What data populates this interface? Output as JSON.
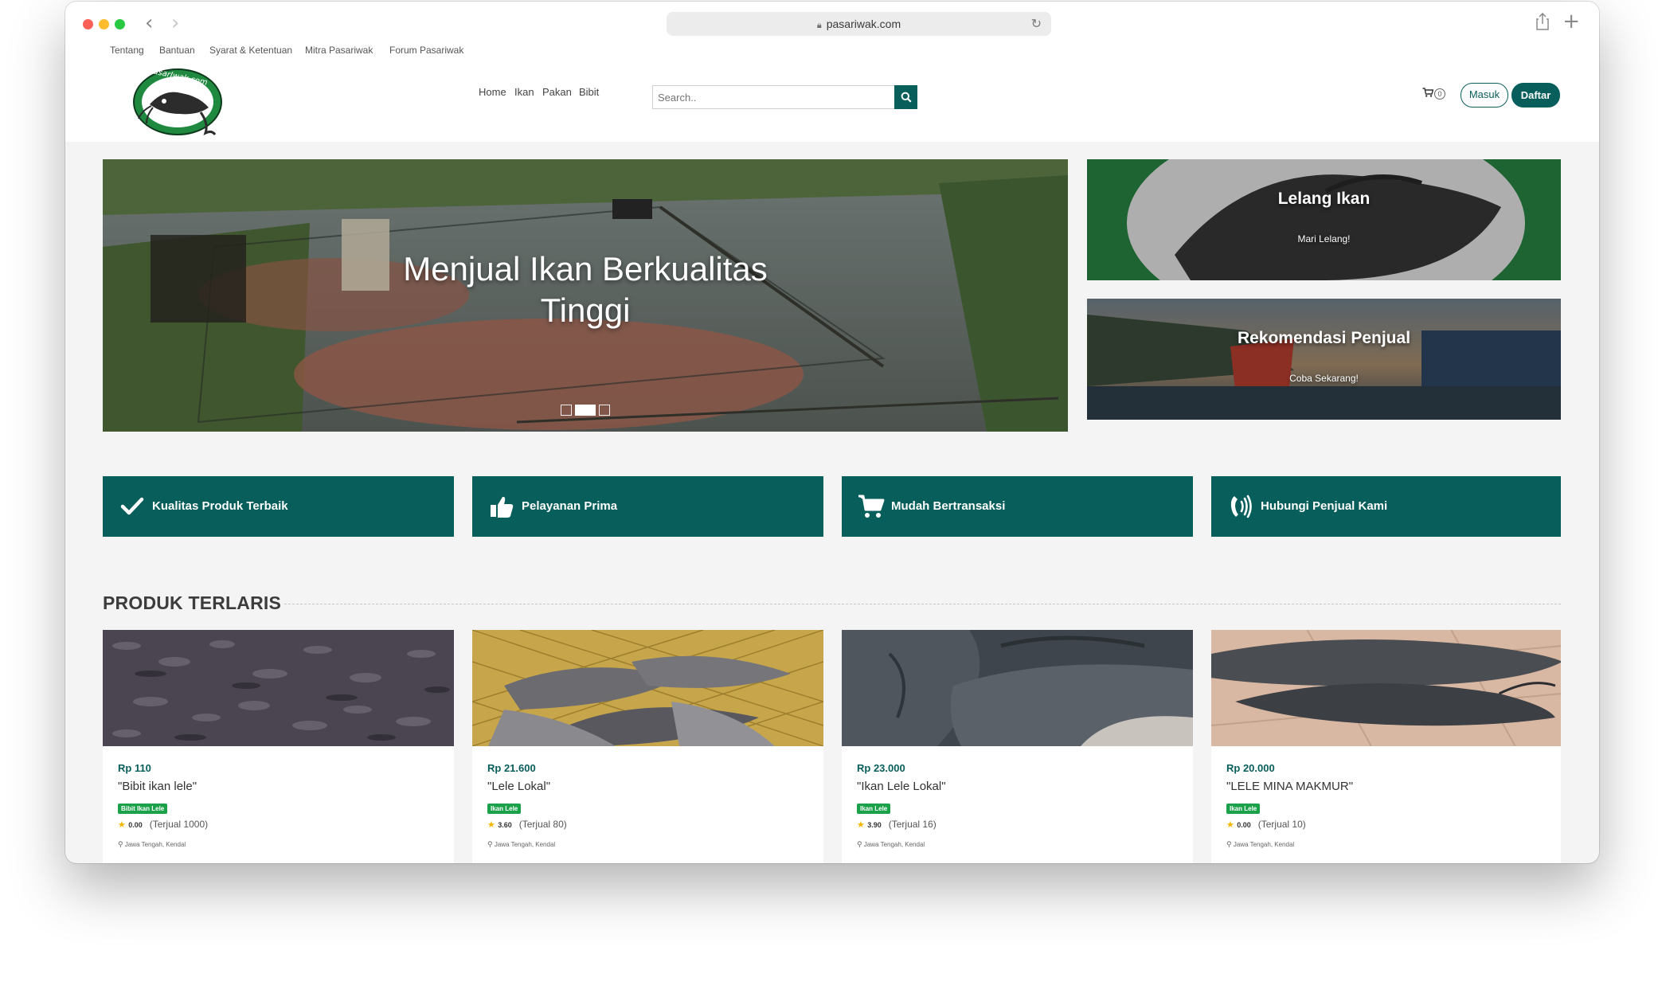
{
  "browser": {
    "url": "pasariwak.com"
  },
  "top_links": [
    {
      "label": "Tentang"
    },
    {
      "label": "Bantuan"
    },
    {
      "label": "Syarat & Ketentuan"
    },
    {
      "label": "Mitra Pasariwak"
    },
    {
      "label": "Forum Pasariwak"
    }
  ],
  "logo": {
    "text": "PasarIwak.com"
  },
  "nav": [
    {
      "label": "Home"
    },
    {
      "label": "Ikan"
    },
    {
      "label": "Pakan"
    },
    {
      "label": "Bibit"
    }
  ],
  "search": {
    "placeholder": "Search.."
  },
  "cart": {
    "count": "0"
  },
  "auth": {
    "login_label": "Masuk",
    "register_label": "Daftar"
  },
  "hero": {
    "title_line1": "Menjual Ikan Berkualitas",
    "title_line2": "Tinggi"
  },
  "promos": [
    {
      "title": "Lelang Ikan",
      "subtitle": "Mari Lelang!"
    },
    {
      "title": "Rekomendasi Penjual",
      "subtitle": "Coba Sekarang!"
    }
  ],
  "features": [
    {
      "label": "Kualitas Produk Terbaik",
      "icon": "check-icon"
    },
    {
      "label": "Pelayanan Prima",
      "icon": "thumbs-up-icon"
    },
    {
      "label": "Mudah Bertransaksi",
      "icon": "cart-icon"
    },
    {
      "label": "Hubungi Penjual Kami",
      "icon": "phone-volume-icon"
    }
  ],
  "bestsellers": {
    "title": "PRODUK TERLARIS",
    "products": [
      {
        "price": "Rp 110",
        "name": "\"Bibit ikan lele\"",
        "category": "Bibit Ikan Lele",
        "rating": "0.00",
        "sold": "(Terjual 1000)",
        "location": "Jawa Tengah, Kendal"
      },
      {
        "price": "Rp 21.600",
        "name": "\"Lele Lokal\"",
        "category": "Ikan Lele",
        "rating": "3.60",
        "sold": "(Terjual 80)",
        "location": "Jawa Tengah, Kendal"
      },
      {
        "price": "Rp 23.000",
        "name": "\"Ikan Lele Lokal\"",
        "category": "Ikan Lele",
        "rating": "3.90",
        "sold": "(Terjual 16)",
        "location": "Jawa Tengah, Kendal"
      },
      {
        "price": "Rp 20.000",
        "name": "\"LELE MINA MAKMUR\"",
        "category": "Ikan Lele",
        "rating": "0.00",
        "sold": "(Terjual 10)",
        "location": "Jawa Tengah, Kendal"
      }
    ]
  },
  "colors": {
    "primary": "#075e5b",
    "badge": "#1aa14a",
    "star": "#f4b400"
  }
}
